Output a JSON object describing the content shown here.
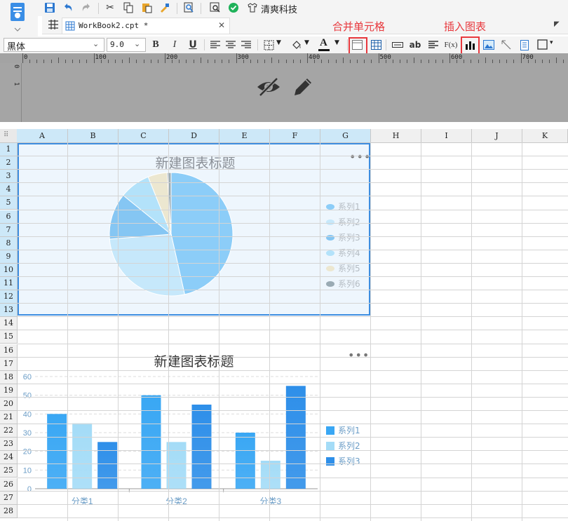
{
  "app": {
    "tab_title": "WorkBook2.cpt *",
    "tab_close": "✕",
    "brand": "清爽科技"
  },
  "format": {
    "font_name": "黑体",
    "font_size": "9.0",
    "bold": "B",
    "italic": "I",
    "underline": "U",
    "text_style": "ab",
    "formula": "F(x)",
    "font_color_letter": "A"
  },
  "annotations": {
    "merge_cells": "合并单元格",
    "insert_chart": "插入图表"
  },
  "ruler": {
    "marks": [
      "0",
      "100",
      "200",
      "300",
      "400",
      "500",
      "600",
      "700"
    ],
    "vmarks": [
      "0",
      "1"
    ]
  },
  "columns": [
    "A",
    "B",
    "C",
    "D",
    "E",
    "F",
    "G",
    "H",
    "I",
    "J",
    "K"
  ],
  "rows": [
    "1",
    "2",
    "3",
    "4",
    "5",
    "6",
    "7",
    "8",
    "9",
    "10",
    "11",
    "12",
    "13",
    "14",
    "15",
    "16",
    "17",
    "18",
    "19",
    "20",
    "21",
    "22",
    "23",
    "24",
    "25",
    "26",
    "27",
    "28"
  ],
  "colors": {
    "selection": "#3d8ee0",
    "annotation_red": "#e8383d",
    "series1_bar": "#39a7f4",
    "series2_bar": "#a4dcf7",
    "series3_bar": "#2e8fe9"
  },
  "chart_data": [
    {
      "type": "pie",
      "title": "新建图表标题",
      "menu": "•••",
      "categories": [
        "系列1",
        "系列2",
        "系列3",
        "系列4",
        "系列5",
        "系列6"
      ],
      "values": [
        46,
        27,
        12,
        8,
        5,
        1
      ],
      "colors": [
        "#8ccdf8",
        "#c6e8fb",
        "#85c6f3",
        "#b3e2fa",
        "#ece7d0",
        "#9aabb4"
      ],
      "legend": "right"
    },
    {
      "type": "bar",
      "title": "新建图表标题",
      "menu": "•••",
      "categories": [
        "分类1",
        "分类2",
        "分类3"
      ],
      "series": [
        {
          "name": "系列1",
          "values": [
            40,
            50,
            30
          ]
        },
        {
          "name": "系列2",
          "values": [
            35,
            25,
            15
          ]
        },
        {
          "name": "系列3",
          "values": [
            25,
            45,
            55
          ]
        }
      ],
      "yticks": [
        "0",
        "10",
        "20",
        "30",
        "40",
        "50",
        "60"
      ],
      "ylim": [
        0,
        60
      ],
      "grid": true,
      "legend": "right"
    }
  ]
}
